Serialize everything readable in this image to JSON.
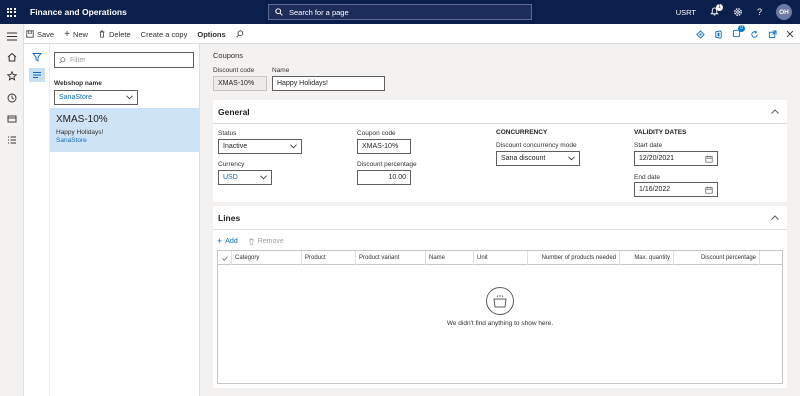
{
  "topbar": {
    "app_title": "Finance and Operations",
    "search_placeholder": "Search for a page",
    "company": "USRT",
    "notification_count": "1",
    "help": "?",
    "avatar_initials": "OH"
  },
  "actionbar": {
    "save": "Save",
    "new": "New",
    "delete": "Delete",
    "create_copy": "Create a copy",
    "options": "Options",
    "attachments_count": "0"
  },
  "list": {
    "filter_placeholder": "Filter",
    "webshop_label": "Webshop name",
    "webshop_value": "SanaStore",
    "items": [
      {
        "code": "XMAS-10%",
        "name": "Happy Holidays!",
        "store": "SanaStore"
      }
    ]
  },
  "page": {
    "breadcrumb": "Coupons",
    "discount_code_label": "Discount code",
    "discount_code_value": "XMAS-10%",
    "name_label": "Name",
    "name_value": "Happy Holidays!"
  },
  "general": {
    "title": "General",
    "status_label": "Status",
    "status_value": "Inactive",
    "currency_label": "Currency",
    "currency_value": "USD",
    "coupon_code_label": "Coupon code",
    "coupon_code_value": "XMAS-10%",
    "discount_pct_label": "Discount percentage",
    "discount_pct_value": "10.00",
    "concurrency_header": "CONCURRENCY",
    "concurrency_mode_label": "Discount concurrency mode",
    "concurrency_mode_value": "Sana discount",
    "validity_header": "VALIDITY DATES",
    "start_date_label": "Start date",
    "start_date_value": "12/20/2021",
    "end_date_label": "End date",
    "end_date_value": "1/16/2022"
  },
  "lines": {
    "title": "Lines",
    "add": "Add",
    "remove": "Remove",
    "columns": [
      "Category",
      "Product",
      "Product variant",
      "Name",
      "Unit",
      "Number of products needed",
      "Max. quantity",
      "Discount percentage"
    ],
    "empty_text": "We didn't find anything to show here."
  },
  "colors": {
    "topbar_bg": "#0b1f4c",
    "accent": "#0f6cbd",
    "selected_row": "#cfe3f7"
  }
}
